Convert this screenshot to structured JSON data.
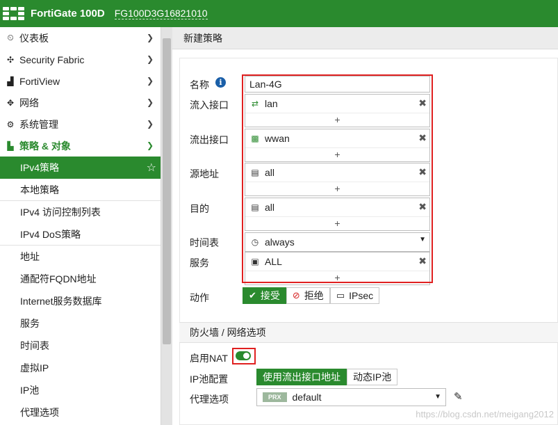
{
  "topbar": {
    "device_name": "FortiGate 100D",
    "serial": "FG100D3G16821010"
  },
  "sidebar": {
    "items": [
      {
        "icon": "dashboard-icon",
        "glyph": "⏲",
        "label": "仪表板"
      },
      {
        "icon": "security-fabric-icon",
        "glyph": "✣",
        "label": "Security Fabric"
      },
      {
        "icon": "fortiview-icon",
        "glyph": "▟",
        "label": "FortiView"
      },
      {
        "icon": "network-icon",
        "glyph": "✥",
        "label": "网络"
      },
      {
        "icon": "gear-icon",
        "glyph": "⚙",
        "label": "系统管理"
      }
    ],
    "section": {
      "icon": "policy-icon",
      "glyph": "▙",
      "label": "策略 & 对象"
    },
    "sub_items": [
      {
        "label": "IPv4策略",
        "active": true
      },
      {
        "label": "本地策略"
      },
      {
        "label": "IPv4 访问控制列表"
      },
      {
        "label": "IPv4 DoS策略"
      },
      {
        "label": "地址"
      },
      {
        "label": "通配符FQDN地址"
      },
      {
        "label": "Internet服务数据库"
      },
      {
        "label": "服务"
      },
      {
        "label": "时间表"
      },
      {
        "label": "虚拟IP"
      },
      {
        "label": "IP池"
      },
      {
        "label": "代理选项"
      }
    ]
  },
  "page": {
    "title": "新建策略"
  },
  "form": {
    "labels": {
      "name": "名称",
      "incoming": "流入接口",
      "outgoing": "流出接口",
      "source": "源地址",
      "destination": "目的",
      "schedule": "时间表",
      "service": "服务",
      "action": "动作"
    },
    "name_value": "Lan-4G",
    "incoming_value": "lan",
    "outgoing_value": "wwan",
    "source_value": "all",
    "destination_value": "all",
    "schedule_value": "always",
    "service_value": "ALL",
    "add_symbol": "+",
    "remove_symbol": "✖",
    "actions": {
      "accept": "接受",
      "deny": "拒绝",
      "ipsec": "IPsec",
      "selected": "accept"
    }
  },
  "firewall_options": {
    "title": "防火墙 / 网络选项",
    "nat_label": "启用NAT",
    "nat_enabled": true,
    "ippool_label": "IP池配置",
    "ippool_options": [
      "使用流出接口地址",
      "动态IP池"
    ],
    "ippool_selected": "使用流出接口地址",
    "proxy_label": "代理选项",
    "proxy_badge": "PRX",
    "proxy_value": "default"
  },
  "watermark": "https://blog.csdn.net/meigang2012",
  "colors": {
    "brand_green": "#2a8a2e",
    "highlight_red": "#e02020"
  }
}
